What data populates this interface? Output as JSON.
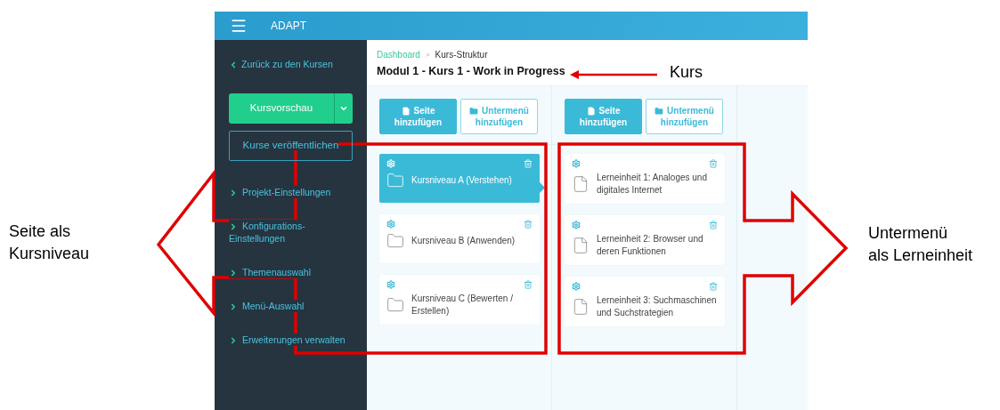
{
  "app": {
    "name": "ADAPT"
  },
  "sidebar": {
    "back_link": "Zurück zu den Kursen",
    "preview_button": "Kursvorschau",
    "publish_button": "Kurse veröffentlichen",
    "items": [
      {
        "label": "Projekt-Einstellungen"
      },
      {
        "label": "Konfigurations-Einstellungen"
      },
      {
        "label": "Themenauswahl"
      },
      {
        "label": "Menü-Auswahl"
      },
      {
        "label": "Erweiterungen verwalten"
      }
    ]
  },
  "breadcrumb": {
    "items": [
      "Dashboard",
      "Kurs-Struktur"
    ],
    "separator": ">"
  },
  "title": "Modul 1 - Kurs 1 - Work in Progress",
  "columns": [
    {
      "buttons": [
        {
          "kind": "add-page",
          "label": "Seite hinzufügen"
        },
        {
          "kind": "add-menu",
          "label": "Untermenü hinzufügen"
        }
      ],
      "items": [
        {
          "kind": "folder",
          "title": "Kursniveau A (Verstehen)",
          "selected": true
        },
        {
          "kind": "folder",
          "title": "Kursniveau B (Anwenden)",
          "selected": false
        },
        {
          "kind": "folder",
          "title": "Kursniveau C (Bewerten / Erstellen)",
          "selected": false
        }
      ]
    },
    {
      "buttons": [
        {
          "kind": "add-page",
          "label": "Seite hinzufügen"
        },
        {
          "kind": "add-menu",
          "label": "Untermenü hinzufügen"
        }
      ],
      "items": [
        {
          "kind": "page",
          "title": "Lerneinheit 1: Analoges und digitales Internet",
          "selected": false
        },
        {
          "kind": "page",
          "title": "Lerneinheit 2: Browser und deren Funktionen",
          "selected": false
        },
        {
          "kind": "page",
          "title": "Lerneinheit 3: Suchmaschinen und Suchstrategien",
          "selected": false
        }
      ]
    }
  ],
  "annotations": {
    "left": [
      "Seite als",
      "Kursniveau"
    ],
    "course": "Kurs",
    "right": [
      "Untermenü",
      "als Lerneinheit"
    ]
  }
}
